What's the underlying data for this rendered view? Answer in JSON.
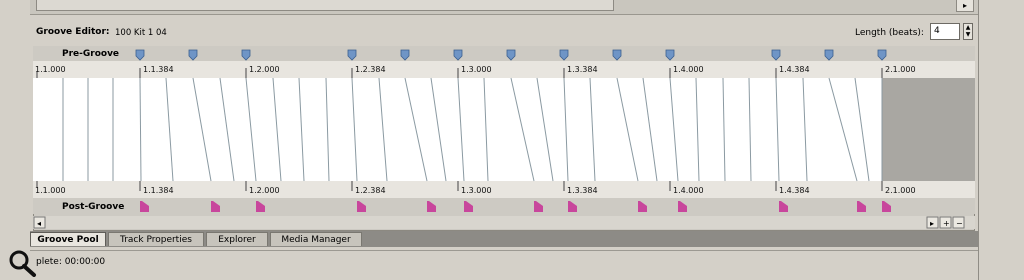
{
  "groove_editor": {
    "title": "Groove Editor:",
    "clip_name": "100 Kit 1 04",
    "length_label": "Length (beats):",
    "length_value": "4",
    "pre_groove_label": "Pre-Groove",
    "post_groove_label": "Post-Groove",
    "ruler_labels": [
      "1.1.000",
      "1.1.384",
      "1.2.000",
      "1.2.384",
      "1.3.000",
      "1.3.384",
      "1.4.000",
      "1.4.384",
      "2.1.000"
    ],
    "colors": {
      "marker": "#6f95c6",
      "post_marker": "#c8469c",
      "shaded": "#a9a7a2",
      "line": "#7f8e95"
    }
  },
  "tabs": [
    {
      "label": "Groove Pool",
      "active": true
    },
    {
      "label": "Track Properties",
      "active": false
    },
    {
      "label": "Explorer",
      "active": false
    },
    {
      "label": "Media Manager",
      "active": false
    }
  ],
  "status": {
    "text": "plete: 00:00:00"
  },
  "scroll_buttons": {
    "up_down": "▸",
    "right": "▸",
    "plus": "+",
    "minus": "−",
    "left": "◂"
  }
}
